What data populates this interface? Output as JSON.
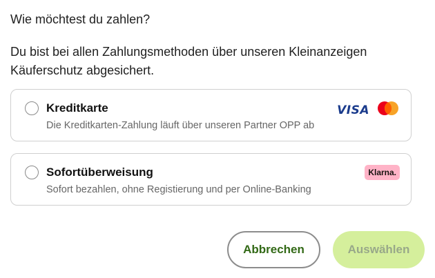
{
  "dialog": {
    "question": "Wie möchtest du zahlen?",
    "info": "Du bist bei allen Zahlungsmethoden über unseren Kleinanzeigen Käuferschutz abgesichert."
  },
  "options": [
    {
      "title": "Kreditkarte",
      "description": "Die Kreditkarten-Zahlung läuft über unseren Partner OPP ab",
      "logos": [
        "VISA",
        "mastercard-icon"
      ]
    },
    {
      "title": "Sofortüberweisung",
      "description": "Sofort bezahlen, ohne Registierung und per Online-Banking",
      "logos": [
        "Klarna."
      ]
    }
  ],
  "buttons": {
    "cancel_label": "Abbrechen",
    "select_label": "Auswählen"
  },
  "colors": {
    "primary_green": "#326916",
    "disabled_button_bg": "#d5ef9c",
    "disabled_button_text": "#98a889",
    "klarna_pink": "#ffb3c7",
    "visa_blue": "#1a3b8c",
    "mastercard_red": "#eb001b",
    "mastercard_orange": "#f79e1b"
  }
}
